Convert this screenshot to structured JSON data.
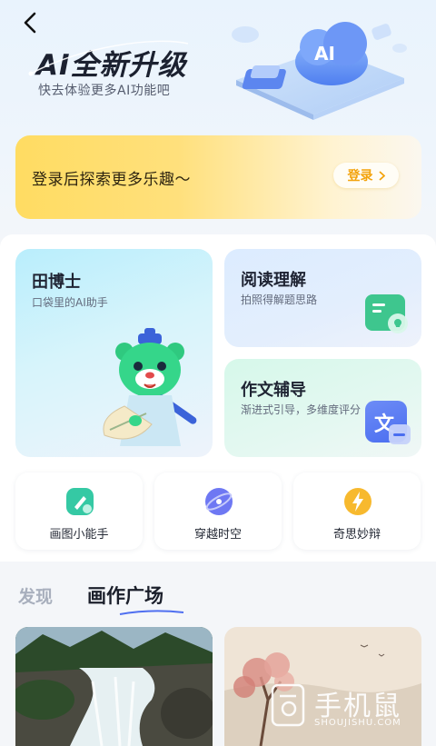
{
  "header": {
    "title": "AI全新升级",
    "subtitle": "快去体验更多AI功能吧",
    "hero_art_label": "AI"
  },
  "login_banner": {
    "text": "登录后探索更多乐趣～",
    "button_label": "登录",
    "button_color": "#f3a30d"
  },
  "features": {
    "tianboshi": {
      "title": "田博士",
      "subtitle": "口袋里的AI助手"
    },
    "reading": {
      "title": "阅读理解",
      "subtitle": "拍照得解题思路"
    },
    "essay": {
      "title": "作文辅导",
      "subtitle": "渐进式引导，多维度评分",
      "icon_char": "文"
    }
  },
  "tools": [
    {
      "label": "画图小能手",
      "icon": "brush-icon",
      "color": "#2cc9a8"
    },
    {
      "label": "穿越时空",
      "icon": "time-travel-icon",
      "color": "#6b73f0"
    },
    {
      "label": "奇思妙辩",
      "icon": "lightning-icon",
      "color": "#f6b72c"
    }
  ],
  "tabs": [
    {
      "label": "发现",
      "active": false
    },
    {
      "label": "画作广场",
      "active": true
    }
  ],
  "watermark": {
    "text": "手机鼠",
    "url": "SHOUJISHU.COM"
  }
}
